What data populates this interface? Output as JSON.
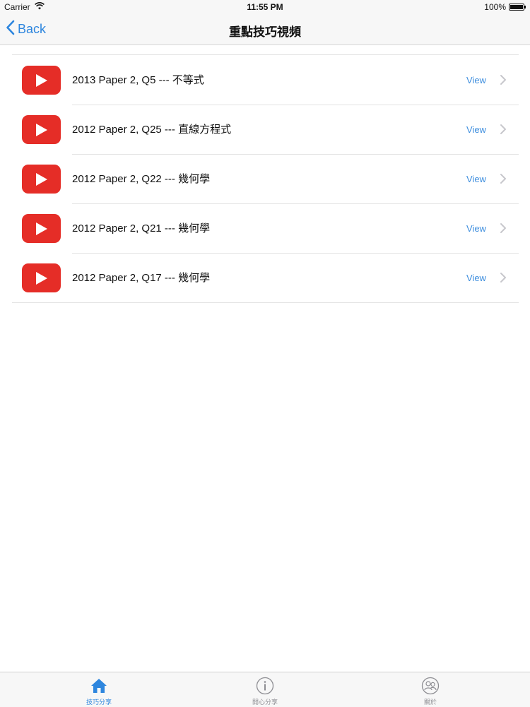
{
  "status_bar": {
    "carrier": "Carrier",
    "time": "11:55 PM",
    "battery": "100%"
  },
  "nav": {
    "back_label": "Back",
    "title": "重點技巧視頻"
  },
  "videos": [
    {
      "title": "2013 Paper 2, Q5 --- 不等式",
      "action": "View"
    },
    {
      "title": "2012 Paper 2, Q25 --- 直線方程式",
      "action": "View"
    },
    {
      "title": "2012 Paper 2, Q22 --- 幾何學",
      "action": "View"
    },
    {
      "title": "2012 Paper 2, Q21 --- 幾何學",
      "action": "View"
    },
    {
      "title": "2012 Paper 2, Q17 --- 幾何學",
      "action": "View"
    }
  ],
  "tabs": [
    {
      "label": "技巧分享",
      "icon": "home-icon",
      "active": true
    },
    {
      "label": "開心分享",
      "icon": "info-icon",
      "active": false
    },
    {
      "label": "關於",
      "icon": "people-icon",
      "active": false
    }
  ],
  "colors": {
    "accent": "#2e86de",
    "youtube_red": "#e52d27",
    "inactive": "#8e8e93"
  }
}
